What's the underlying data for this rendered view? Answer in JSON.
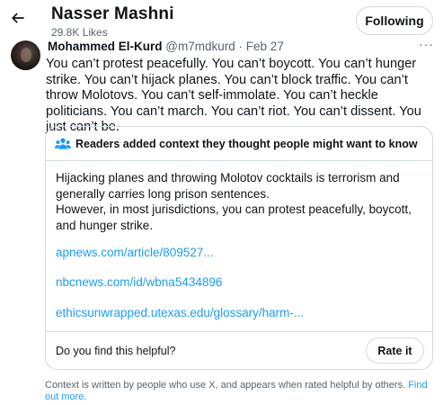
{
  "header": {
    "back_icon": "arrow-left-icon",
    "profile_name": "Nasser Mashni",
    "likes": "29.8K Likes",
    "follow_label": "Following"
  },
  "tweet": {
    "author": "Mohammed El-Kurd",
    "handle": "@m7mdkurd",
    "separator": "·",
    "date": "Feb 27",
    "more_icon": "more-dots-icon",
    "more_glyph": "···",
    "text": "You can’t protest peacefully. You can’t boycott. You can’t hunger strike. You can’t hijack planes. You can’t block traffic. You can’t throw Molotovs. You can’t self-immolate. You can’t heckle politicians. You can’t march. You can’t riot. You can’t dissent. You just can’t be."
  },
  "community_note": {
    "icon": "people-icon",
    "title": "Readers added context they thought people might want to know",
    "body": "Hijacking planes and throwing Molotov cocktails is terrorism and generally carries long prison sentences.\nHowever, in most jurisdictions, you can protest peacefully, boycott, and hunger strike.",
    "links": [
      "apnews.com/article/809527...",
      "nbcnews.com/id/wbna5434896",
      "ethicsunwrapped.utexas.edu/glossary/harm-..."
    ],
    "helpful_question": "Do you find this helpful?",
    "rate_label": "Rate it"
  },
  "context_info": {
    "text": "Context is written by people who use X, and appears when rated helpful by others.",
    "link": "Find out more."
  },
  "colors": {
    "text": "#0f1419",
    "secondary": "#536471",
    "link": "#1d9bf0",
    "border": "#cfd9de"
  }
}
